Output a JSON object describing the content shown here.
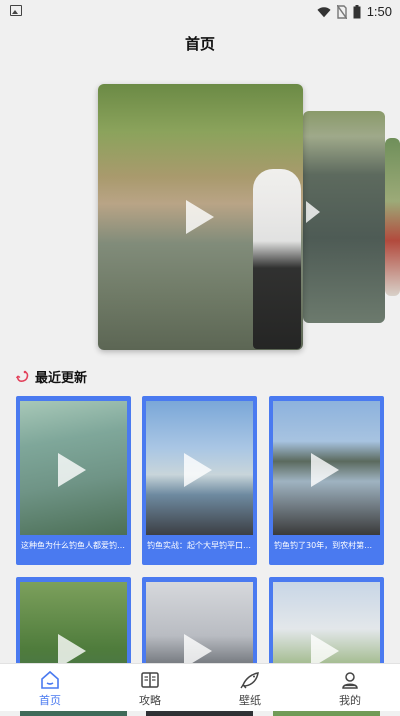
{
  "status_bar": {
    "time": "1:50",
    "icons": [
      "gallery-icon",
      "wifi-icon",
      "no-sim-icon",
      "battery-icon"
    ]
  },
  "header": {
    "title": "首页"
  },
  "carousel": {
    "slides": [
      "slide-1",
      "slide-2",
      "slide-3"
    ],
    "active_index": 0
  },
  "recent": {
    "title": "最近更新",
    "icon": "hook-icon",
    "items": [
      {
        "caption": "这种鱼为什么钓鱼人都爱钓…"
      },
      {
        "caption": "钓鱼实战：起个大早钓平口…"
      },
      {
        "caption": "钓鱼钓了30年，到农村第…"
      },
      {
        "caption": ""
      },
      {
        "caption": ""
      },
      {
        "caption": ""
      }
    ]
  },
  "tabbar": {
    "tabs": [
      {
        "label": "首页",
        "icon": "home-icon",
        "active": true
      },
      {
        "label": "攻略",
        "icon": "book-icon",
        "active": false
      },
      {
        "label": "壁纸",
        "icon": "fish-icon",
        "active": false
      },
      {
        "label": "我的",
        "icon": "user-icon",
        "active": false
      }
    ]
  },
  "colors": {
    "accent": "#4a7af0",
    "background": "#f0f0f0"
  }
}
